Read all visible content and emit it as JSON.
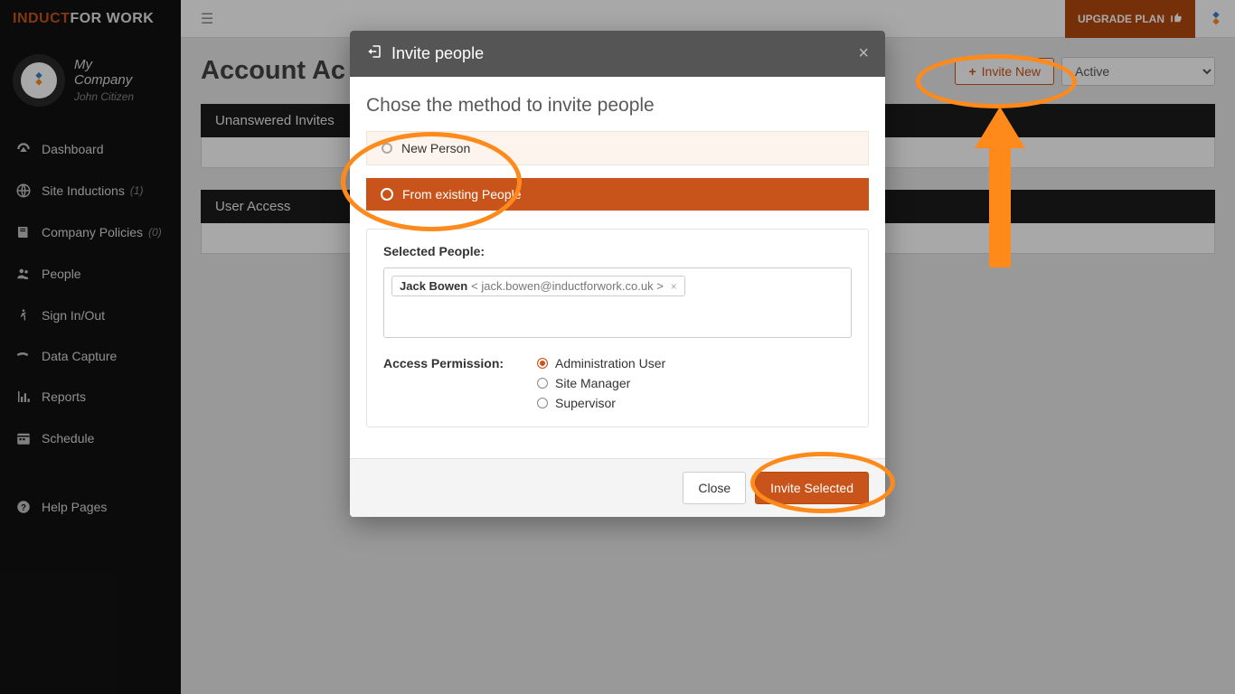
{
  "brand": {
    "part1": "INDUCT",
    "part2": "FOR WORK"
  },
  "user": {
    "company_l1": "My",
    "company_l2": "Company",
    "name": "John Citizen"
  },
  "nav": {
    "dashboard": "Dashboard",
    "site_inductions": "Site Inductions",
    "site_inductions_count": "(1)",
    "company_policies": "Company Policies",
    "company_policies_count": "(0)",
    "people": "People",
    "signinout": "Sign In/Out",
    "data_capture": "Data Capture",
    "reports": "Reports",
    "schedule": "Schedule",
    "help": "Help Pages"
  },
  "topbar": {
    "upgrade": "UPGRADE PLAN"
  },
  "page": {
    "title": "Account Ac",
    "invite_new": "Invite New",
    "status_selected": "Active",
    "panel1": "Unanswered Invites",
    "panel2": "User Access"
  },
  "modal": {
    "title": "Invite people",
    "subtitle": "Chose the method to invite people",
    "opt_new": "New Person",
    "opt_existing": "From existing People",
    "selected_label": "Selected People:",
    "chip_name": "Jack Bowen",
    "chip_email": "< jack.bowen@inductforwork.co.uk >",
    "perm_label": "Access Permission:",
    "perm_admin": "Administration User",
    "perm_site": "Site Manager",
    "perm_supervisor": "Supervisor",
    "btn_close": "Close",
    "btn_invite": "Invite Selected"
  }
}
